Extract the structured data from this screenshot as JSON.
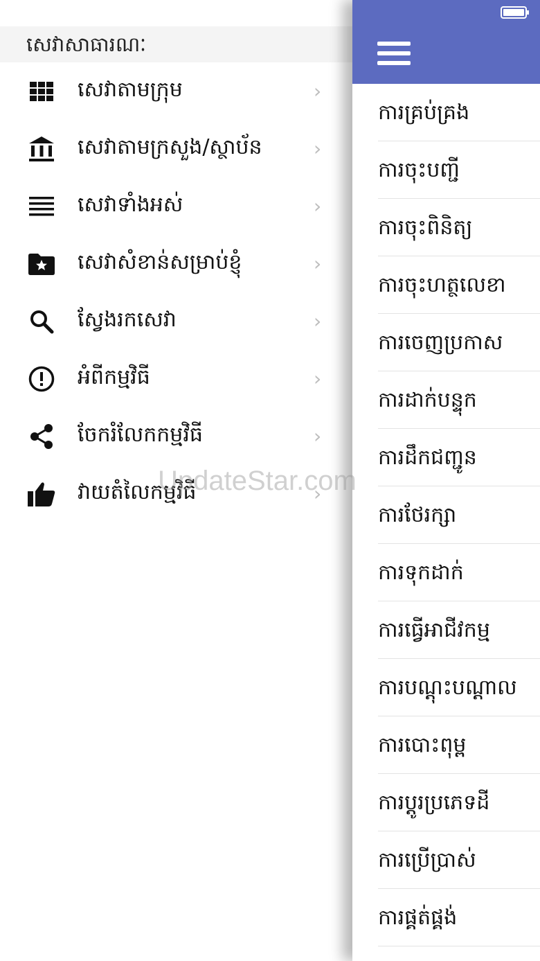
{
  "drawer": {
    "header": "សេវាសាធារណៈ",
    "items": [
      {
        "label": "សេវាតាមក្រុម",
        "icon": "grid-icon"
      },
      {
        "label": "សេវាតាមក្រសួង/ស្ថាប័ន",
        "icon": "institution-icon"
      },
      {
        "label": "សេវាទាំងអស់",
        "icon": "list-icon"
      },
      {
        "label": "សេវាសំខាន់សម្រាប់ខ្ញុំ",
        "icon": "star-folder-icon"
      },
      {
        "label": "ស្វែងរកសេវា",
        "icon": "search-icon"
      },
      {
        "label": "អំពីកម្មវិធី",
        "icon": "info-icon"
      },
      {
        "label": "ចែករំលែកកម្មវិធី",
        "icon": "share-icon"
      },
      {
        "label": "វាយតំលៃកម្មវិធី",
        "icon": "thumbs-up-icon"
      }
    ],
    "chevron": "›"
  },
  "appbar": {
    "menu_icon": "hamburger-menu-icon",
    "battery_icon": "battery-icon"
  },
  "list": [
    "ការគ្រប់គ្រង",
    "ការចុះបញ្ជី",
    "ការចុះពិនិត្យ",
    "ការចុះហត្ថលេខា",
    "ការចេញប្រកាស",
    "ការដាក់បន្ទុក",
    "ការដឹកជញ្ជូន",
    "ការថែរក្សា",
    "ការទុកដាក់",
    "ការធ្វើអាជីវកម្ម",
    "ការបណ្តុះបណ្តាល",
    "ការបោះពុម្ព",
    "ការប្តូរប្រភេទដី",
    "ការប្រើប្រាស់",
    "ការផ្គត់ផ្គង់"
  ],
  "watermark": "UpdateStar.com",
  "colors": {
    "appbar": "#5c6bc0",
    "header_bg": "#f4f4f4",
    "chevron": "#bdbdbd"
  }
}
